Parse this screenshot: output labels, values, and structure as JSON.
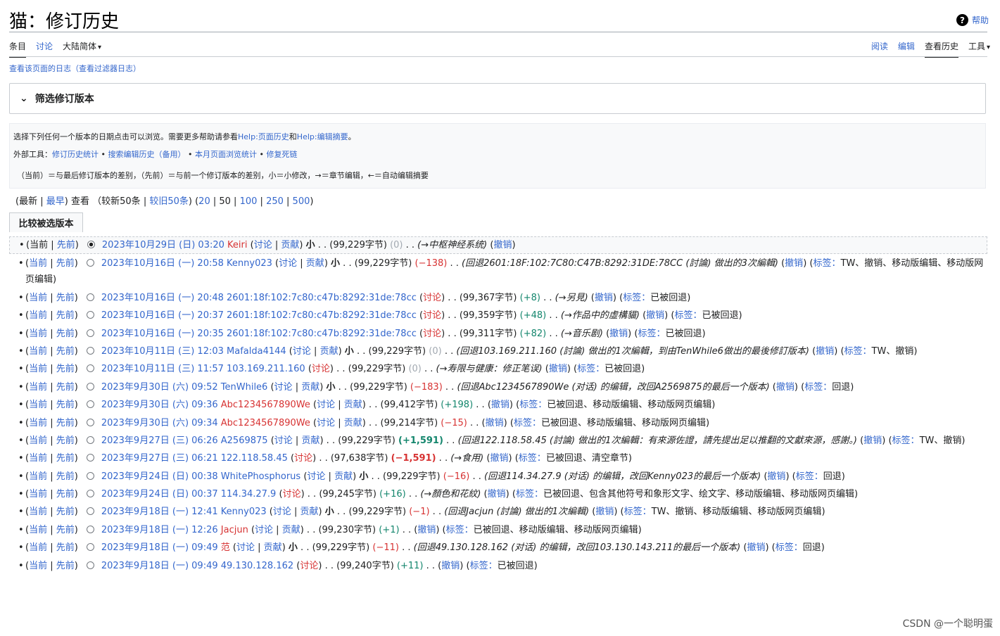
{
  "page": {
    "title": "猫：修订历史",
    "help": "帮助"
  },
  "tabs_left": [
    "条目",
    "讨论",
    "大陆简体"
  ],
  "tabs_right": [
    "阅读",
    "编辑",
    "查看历史",
    "工具"
  ],
  "logs": {
    "page_log": "查看该页面的日志",
    "filter_log": "（查看过滤器日志）"
  },
  "filter": {
    "label": "筛选修订版本"
  },
  "info": {
    "line1_prefix": "选择下列任何一个版本的日期点击可以浏览。需要更多帮助请参看",
    "help1": "Help:页面历史",
    "and": "和",
    "help2": "Help:编辑摘要",
    "end": "。",
    "tools_label": "外部工具：",
    "tools": [
      "修订历史统计",
      "搜索编辑历史",
      "（备用）",
      "本月页面浏览统计",
      "修复死链"
    ],
    "legend": "（当前）＝与最后修订版本的差别，（先前）＝与前一个修订版本的差别，小＝小修改，→＝章节编辑，←＝自动编辑摘要"
  },
  "nav": {
    "newest": "最新",
    "oldest": "最早",
    "view": "查看",
    "newer": "（较新50条",
    "older": "较旧50条",
    "limits": [
      "20",
      "50",
      "100",
      "250",
      "500"
    ]
  },
  "compare_button": "比较被选版本",
  "labels": {
    "cur": "当前",
    "prev": "先前",
    "talk": "讨论",
    "contrib": "贡献",
    "minor": "小",
    "undo": "撤销",
    "tags": "标签："
  },
  "revisions": [
    {
      "date": "2023年10月29日 (日) 03:20",
      "user": "Keiri",
      "userRed": true,
      "links": "talk_contrib",
      "minor": true,
      "size": "(99,229字节)",
      "diff": "(0)",
      "diffClass": "gray",
      "summary": "(→中枢神经系统)",
      "tags": "",
      "wrap": false
    },
    {
      "date": "2023年10月16日 (一) 20:58",
      "user": "Kenny023",
      "userRed": false,
      "links": "talk_contrib",
      "minor": true,
      "size": "(99,229字节)",
      "diff": "(−138)",
      "diffClass": "red",
      "summary": "(回退2601:18F:102:7C80:C47B:8292:31DE:78CC (討論) 做出的3次編輯)",
      "tags": "TW、撤销、移动版编辑、移动版网页编辑",
      "wrap": true
    },
    {
      "date": "2023年10月16日 (一) 20:48",
      "user": "2601:18f:102:7c80:c47b:8292:31de:78cc",
      "userRed": false,
      "links": "talk",
      "minor": false,
      "size": "(99,367字节)",
      "diff": "(+8)",
      "diffClass": "grn",
      "summary": "(→另見)",
      "tags": "已被回退",
      "wrap": false
    },
    {
      "date": "2023年10月16日 (一) 20:37",
      "user": "2601:18f:102:7c80:c47b:8292:31de:78cc",
      "userRed": false,
      "links": "talk",
      "minor": false,
      "size": "(99,359字节)",
      "diff": "(+48)",
      "diffClass": "grn",
      "summary": "(→作品中的虛構貓)",
      "tags": "已被回退",
      "wrap": false
    },
    {
      "date": "2023年10月16日 (一) 20:35",
      "user": "2601:18f:102:7c80:c47b:8292:31de:78cc",
      "userRed": false,
      "links": "talk",
      "minor": false,
      "size": "(99,311字节)",
      "diff": "(+82)",
      "diffClass": "grn",
      "summary": "(→音乐剧)",
      "tags": "已被回退",
      "wrap": false
    },
    {
      "date": "2023年10月11日 (三) 12:03",
      "user": "Mafalda4144",
      "userRed": false,
      "links": "talk_contrib",
      "minor": true,
      "size": "(99,229字节)",
      "diff": "(0)",
      "diffClass": "gray",
      "summary": "(回退103.169.211.160 (討論) 做出的1次編輯，到由TenWhile6做出的最後修訂版本)",
      "tags": "TW、撤销",
      "wrap": true
    },
    {
      "date": "2023年10月11日 (三) 11:57",
      "user": "103.169.211.160",
      "userRed": false,
      "links": "talk",
      "minor": false,
      "size": "(99,229字节)",
      "diff": "(0)",
      "diffClass": "gray",
      "summary": "(→寿限与健康：修正笔误)",
      "tags": "已被回退",
      "wrap": false
    },
    {
      "date": "2023年9月30日 (六) 09:52",
      "user": "TenWhile6",
      "userRed": false,
      "links": "talk_contrib",
      "minor": true,
      "size": "(99,229字节)",
      "diff": "(−183)",
      "diffClass": "red",
      "summary": "(回退Abc1234567890We (对话) 的编辑，改回A2569875的最后一个版本)",
      "tags": "回退",
      "wrap": false
    },
    {
      "date": "2023年9月30日 (六) 09:36",
      "user": "Abc1234567890We",
      "userRed": true,
      "links": "talk_contrib",
      "minor": false,
      "size": "(99,412字节)",
      "diff": "(+198)",
      "diffClass": "grn",
      "summary": "",
      "tags": "已被回退、移动版编辑、移动版网页编辑",
      "wrap": false
    },
    {
      "date": "2023年9月30日 (六) 09:34",
      "user": "Abc1234567890We",
      "userRed": true,
      "links": "talk_contrib",
      "minor": false,
      "size": "(99,214字节)",
      "diff": "(−15)",
      "diffClass": "red",
      "summary": "",
      "tags": "已被回退、移动版编辑、移动版网页编辑",
      "wrap": false
    },
    {
      "date": "2023年9月27日 (三) 06:26",
      "user": "A2569875",
      "userRed": false,
      "links": "talk_contrib",
      "minor": false,
      "size": "(99,229字节)",
      "diff": "(+1,591)",
      "diffClass": "grn bold",
      "summary": "(回退122.118.58.45 (討論) 做出的1次編輯：有來源佐證，請先提出足以推翻的文獻來源，感謝。)",
      "tags": "TW、撤销",
      "wrap": true
    },
    {
      "date": "2023年9月27日 (三) 06:21",
      "user": "122.118.58.45",
      "userRed": false,
      "links": "talk",
      "minor": false,
      "size": "(97,638字节)",
      "diff": "(−1,591)",
      "diffClass": "red bold",
      "summary": "(→食用)",
      "tags": "已被回退、清空章节",
      "wrap": false
    },
    {
      "date": "2023年9月24日 (日) 00:38",
      "user": "WhitePhosphorus",
      "userRed": false,
      "links": "talk_contrib",
      "minor": true,
      "size": "(99,229字节)",
      "diff": "(−16)",
      "diffClass": "red",
      "summary": "(回退114.34.27.9 (对话) 的编辑，改回Kenny023的最后一个版本)",
      "tags": "回退",
      "wrap": false
    },
    {
      "date": "2023年9月24日 (日) 00:37",
      "user": "114.34.27.9",
      "userRed": false,
      "links": "talk",
      "minor": false,
      "size": "(99,245字节)",
      "diff": "(+16)",
      "diffClass": "grn",
      "summary": "(→顏色和花紋)",
      "tags": "已被回退、包含其他符号和象形文字、绘文字、移动版编辑、移动版网页编辑",
      "wrap": true
    },
    {
      "date": "2023年9月18日 (一) 12:41",
      "user": "Kenny023",
      "userRed": false,
      "links": "talk_contrib",
      "minor": true,
      "size": "(99,229字节)",
      "diff": "(−1)",
      "diffClass": "red",
      "summary": "(回退Jacjun (討論) 做出的1次編輯)",
      "tags": "TW、撤销、移动版编辑、移动版网页编辑",
      "wrap": false
    },
    {
      "date": "2023年9月18日 (一) 12:26",
      "user": "Jacjun",
      "userRed": true,
      "links": "talk_contrib",
      "minor": false,
      "size": "(99,230字节)",
      "diff": "(+1)",
      "diffClass": "grn",
      "summary": "",
      "tags": "已被回退、移动版编辑、移动版网页编辑",
      "wrap": false
    },
    {
      "date": "2023年9月18日 (一) 09:49",
      "user": "范",
      "userRed": true,
      "links": "talk_contrib",
      "minor": true,
      "size": "(99,229字节)",
      "diff": "(−11)",
      "diffClass": "red",
      "summary": "(回退49.130.128.162 (对话) 的编辑，改回103.130.143.211的最后一个版本)",
      "tags": "回退",
      "wrap": false
    },
    {
      "date": "2023年9月18日 (一) 09:49",
      "user": "49.130.128.162",
      "userRed": false,
      "links": "talk",
      "minor": false,
      "size": "(99,240字节)",
      "diff": "(+11)",
      "diffClass": "grn",
      "summary": "",
      "tags": "已被回退",
      "wrap": false
    }
  ],
  "watermark": "CSDN @一个聪明蛋"
}
